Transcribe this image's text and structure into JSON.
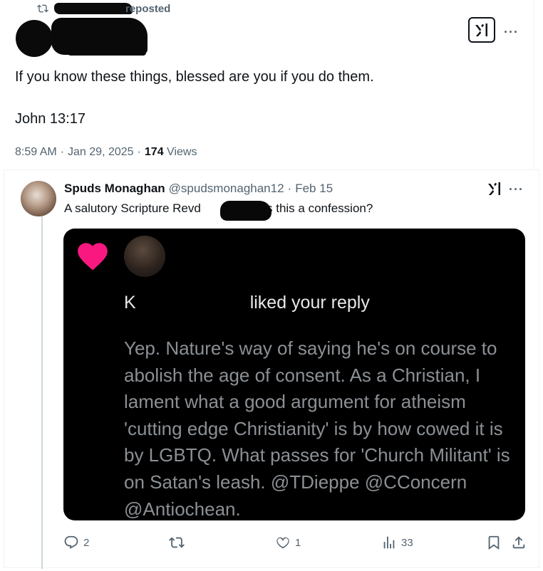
{
  "repost": {
    "label": "reposted"
  },
  "top_tweet": {
    "text": "If you know these things, blessed are you if you do them.",
    "reference": "John 13:17",
    "time": "8:59 AM",
    "sep1": "·",
    "date": "Jan 29, 2025",
    "sep2": "·",
    "views_count": "174",
    "views_label": "Views"
  },
  "reply": {
    "name": "Spuds Monaghan",
    "handle": "@spudsmonaghan12",
    "sep": "·",
    "date": "Feb 15",
    "text_before": "A salutory Scripture Revd",
    "text_after": "Is this a confession?",
    "media": {
      "notification": "liked your reply",
      "notification_prefix": "K",
      "quote": "Yep. Nature's way of saying he's on course to abolish the age of consent. As a Christian, I lament what a good argument for atheism 'cutting edge Christianity' is by how cowed it is by LGBTQ. What passes for 'Church Militant' is on Satan's leash. @TDieppe @CConcern @Antiochean."
    },
    "actions": {
      "replies": "2",
      "reposts": "",
      "likes": "1",
      "views": "33"
    }
  },
  "icons": {
    "repost": "repost-icon",
    "grok": "grok-icon",
    "more": "more-icon",
    "reply": "reply-icon",
    "like": "like-icon",
    "views": "views-icon",
    "bookmark": "bookmark-icon",
    "share": "share-icon",
    "heart": "heart-icon"
  },
  "colors": {
    "text": "#0f1419",
    "muted": "#536471",
    "heart": "#f91880",
    "media_bg": "#000000"
  }
}
